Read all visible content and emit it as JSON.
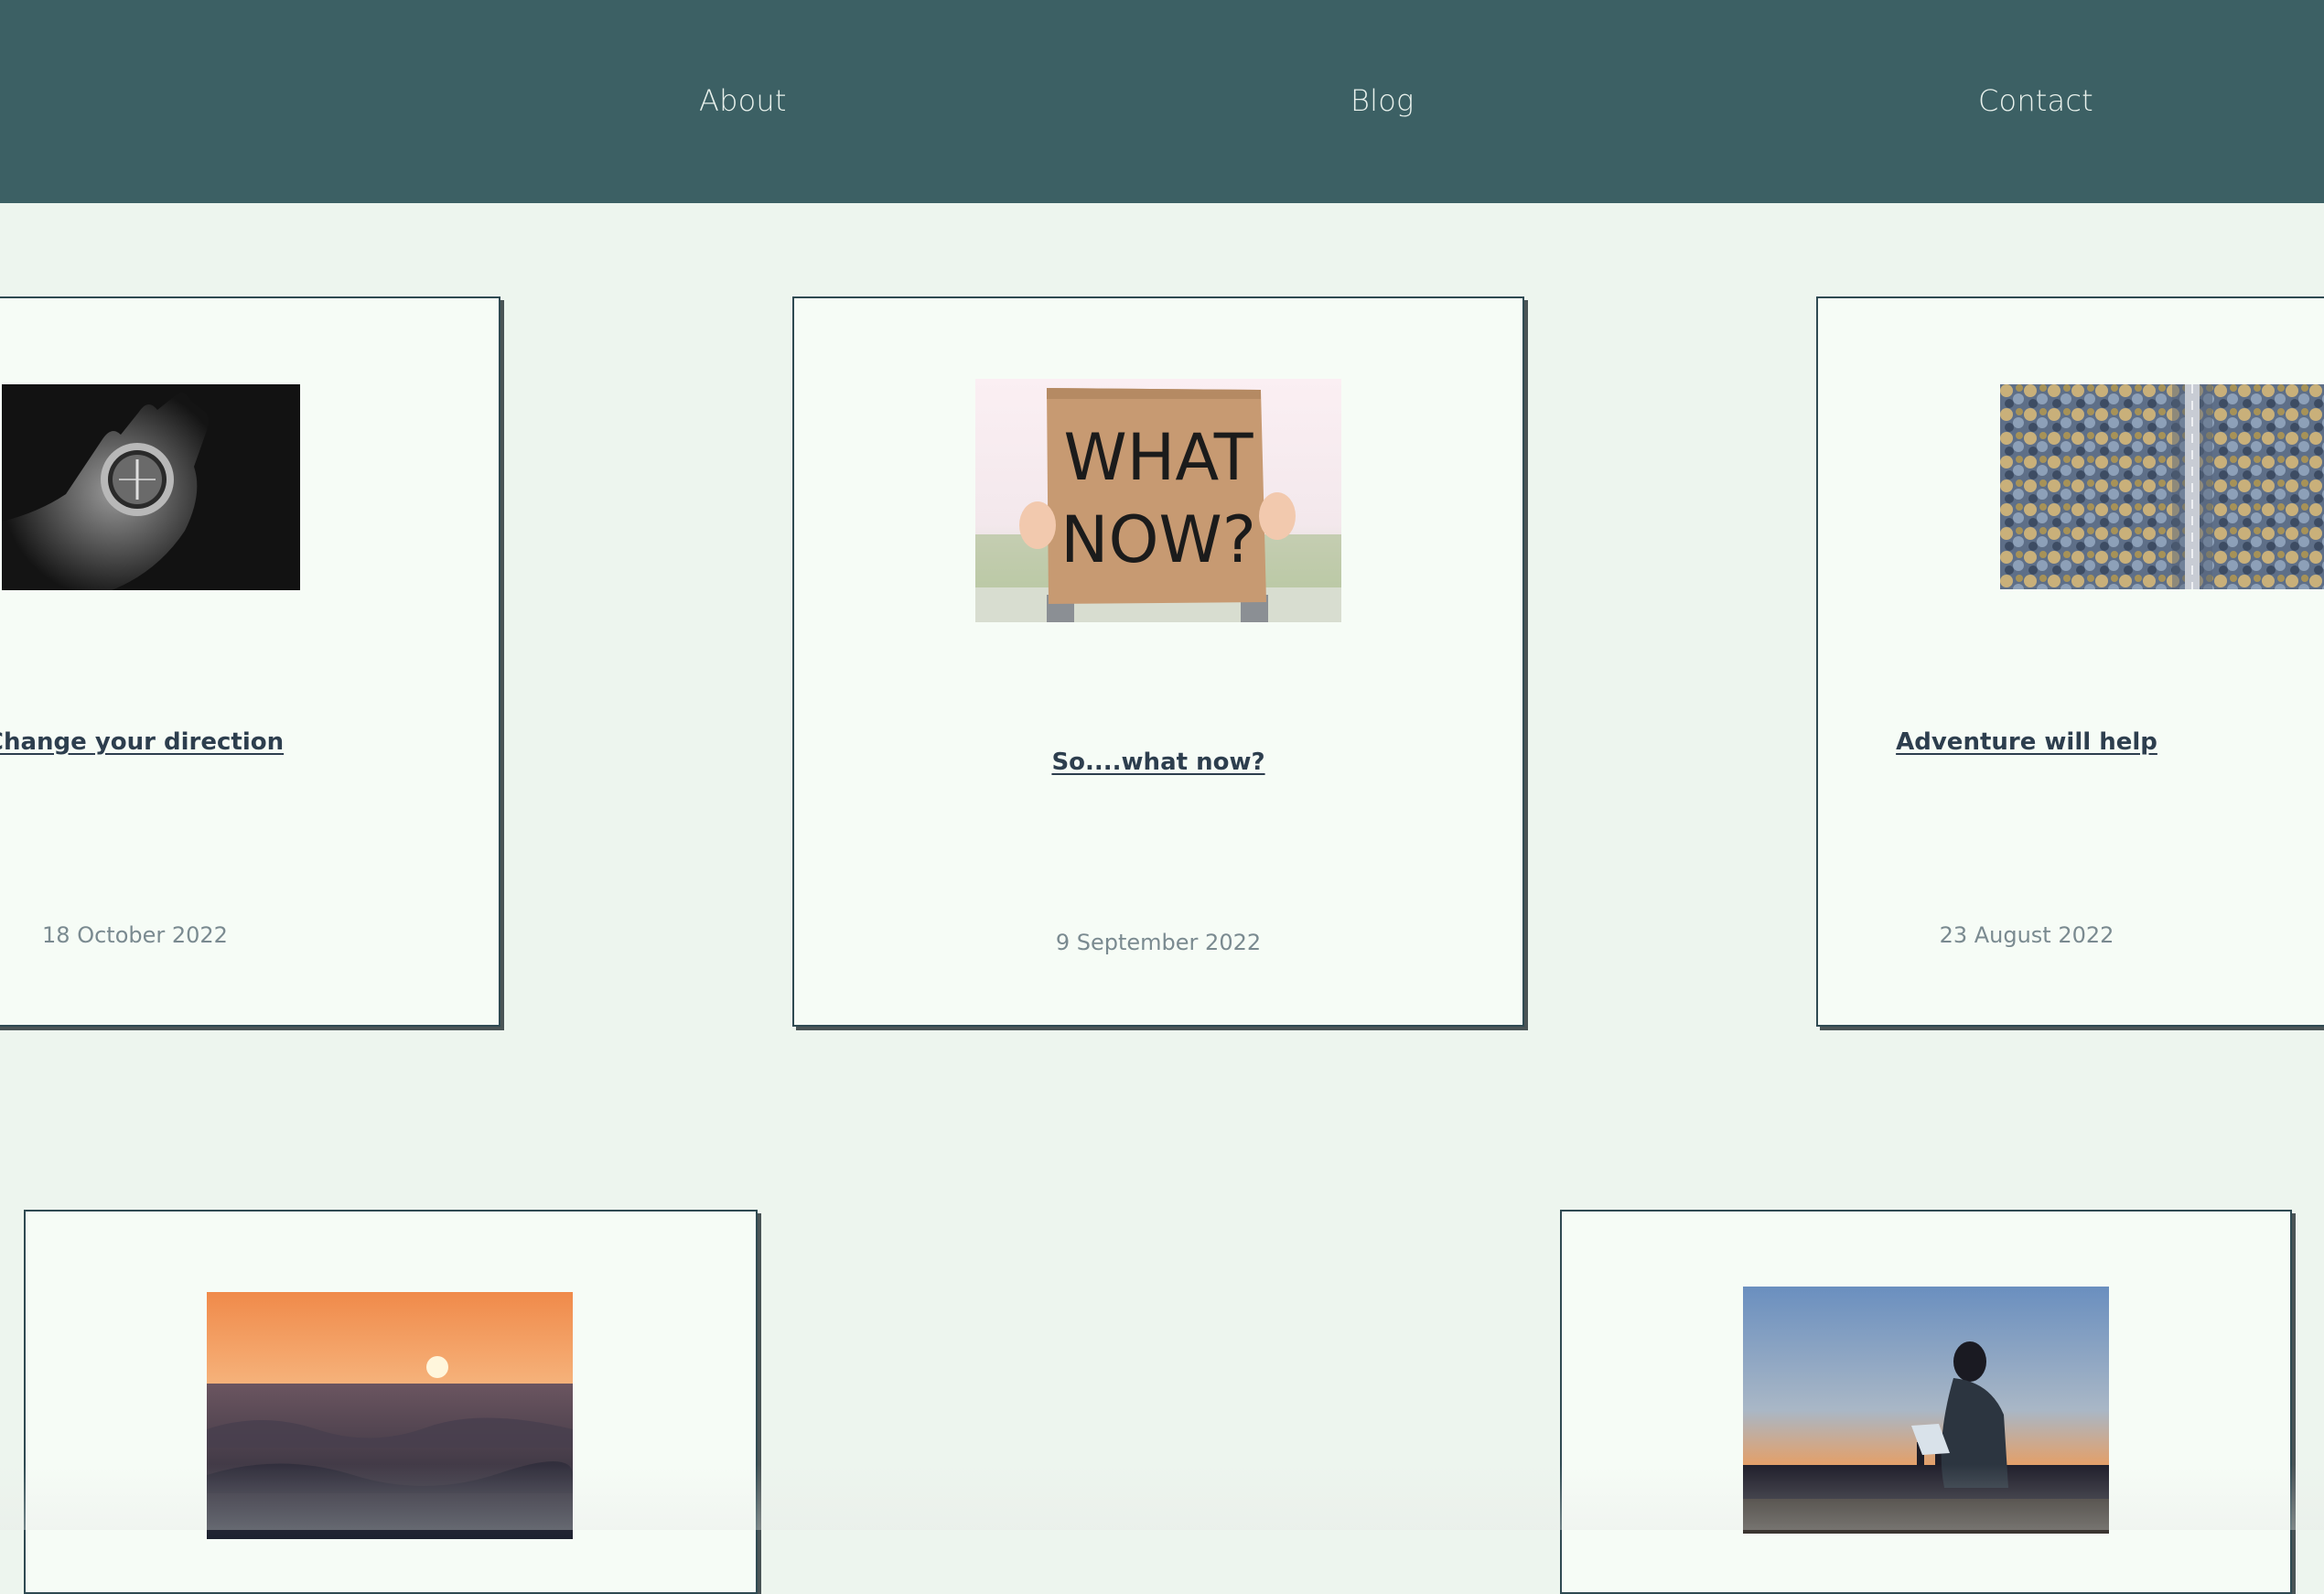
{
  "nav": {
    "about": "About",
    "blog": "Blog",
    "contact": "Contact"
  },
  "posts": [
    {
      "title": "Change your direction",
      "date": "18 October 2022",
      "image": "compass-in-hand-photo"
    },
    {
      "title": "So....what now?",
      "date": "9 September 2022",
      "image": "what-now-sign-photo"
    },
    {
      "title": "Adventure will help",
      "date": "23 August 2022",
      "image": "forest-road-aerial-photo"
    },
    {
      "title": "",
      "date": "",
      "image": "ocean-sunset-photo"
    },
    {
      "title": "",
      "date": "",
      "image": "person-laptop-city-photo"
    }
  ],
  "colors": {
    "header_bg": "#3C6064",
    "page_bg": "#EDF5EE",
    "card_bg": "#F6FCF6",
    "card_border": "#2F4A52",
    "title": "#2D3E4E",
    "date": "#7A8A90"
  }
}
